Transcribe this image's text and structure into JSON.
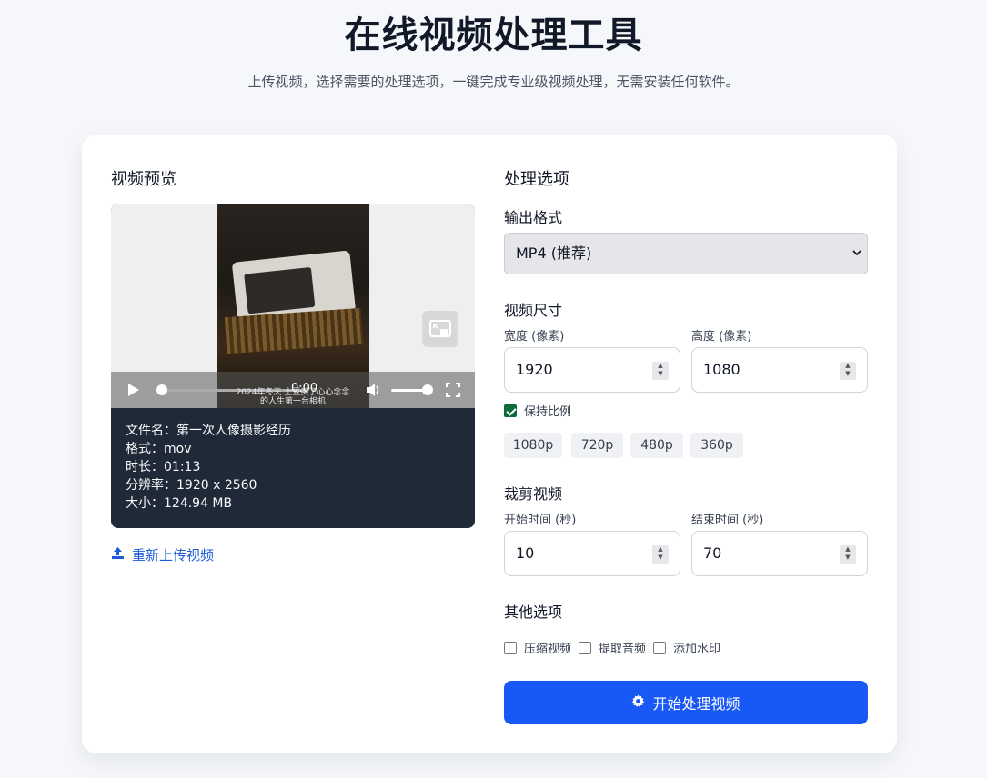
{
  "header": {
    "title": "在线视频处理工具",
    "subtitle": "上传视频，选择需要的处理选项，一键完成专业级视频处理，无需安装任何软件。"
  },
  "preview": {
    "heading": "视频预览",
    "player": {
      "time": "0:00",
      "caption_line1": "2024年冬天 土豆买了心心念念",
      "caption_line2": "的人生第一台相机",
      "icons": [
        "play-icon",
        "volume-icon",
        "fullscreen-icon",
        "picture-in-picture-icon"
      ]
    },
    "info": {
      "filename": "文件名：第一次人像摄影经历",
      "format": "格式：mov",
      "duration": "时长：01:13",
      "resolution": "分辨率：1920 x 2560",
      "size": "大小：124.94 MB"
    },
    "reupload_label": "重新上传视频"
  },
  "options": {
    "heading": "处理选项",
    "output_format": {
      "label": "输出格式",
      "selected": "MP4 (推荐)"
    },
    "size": {
      "label": "视频尺寸",
      "width_label": "宽度 (像素)",
      "width_value": "1920",
      "height_label": "高度 (像素)",
      "height_value": "1080",
      "keep_ratio_label": "保持比例",
      "keep_ratio_checked": true,
      "presets": [
        "1080p",
        "720p",
        "480p",
        "360p"
      ]
    },
    "trim": {
      "label": "裁剪视频",
      "start_label": "开始时间 (秒)",
      "start_value": "10",
      "end_label": "结束时间 (秒)",
      "end_value": "70"
    },
    "other": {
      "label": "其他选项",
      "compress_label": "压缩视频",
      "extract_audio_label": "提取音频",
      "watermark_label": "添加水印"
    },
    "process_label": "开始处理视频"
  },
  "colors": {
    "accent": "#1859f5",
    "link": "#1d5bd8",
    "info_bg": "#1f2937",
    "checkbox_checked": "#0b6b3a"
  }
}
